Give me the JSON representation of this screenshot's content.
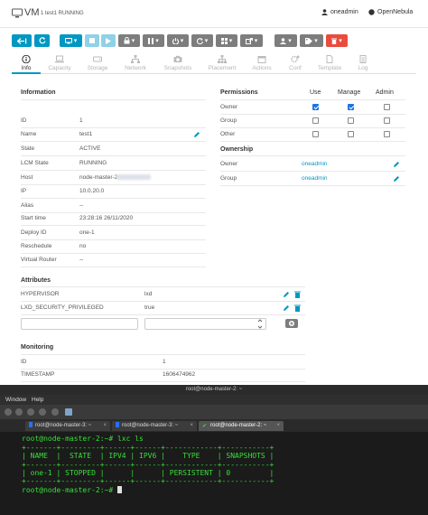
{
  "header": {
    "title": "VM",
    "subtitle": "1 test1 RUNNING",
    "user": "oneadmin",
    "zone": "OpenNebula"
  },
  "tabs": [
    {
      "label": "Info",
      "icon": "info-icon"
    },
    {
      "label": "Capacity",
      "icon": "laptop-icon"
    },
    {
      "label": "Storage",
      "icon": "drive-icon"
    },
    {
      "label": "Network",
      "icon": "network-icon"
    },
    {
      "label": "Snapshots",
      "icon": "camera-icon"
    },
    {
      "label": "Placement",
      "icon": "sitemap-icon"
    },
    {
      "label": "Actions",
      "icon": "calendar-icon"
    },
    {
      "label": "Conf",
      "icon": "gears-icon"
    },
    {
      "label": "Template",
      "icon": "file-icon"
    },
    {
      "label": "Log",
      "icon": "log-icon"
    }
  ],
  "information": {
    "heading": "Information",
    "rows": [
      {
        "label": "ID",
        "value": "1"
      },
      {
        "label": "Name",
        "value": "test1"
      },
      {
        "label": "State",
        "value": "ACTIVE"
      },
      {
        "label": "LCM State",
        "value": "RUNNING"
      },
      {
        "label": "Host",
        "value": "node-master-2"
      },
      {
        "label": "IP",
        "value": "10.0.20.0"
      },
      {
        "label": "Alias",
        "value": "--"
      },
      {
        "label": "Start time",
        "value": "23:28:16 26/11/2020"
      },
      {
        "label": "Deploy ID",
        "value": "one-1"
      },
      {
        "label": "Reschedule",
        "value": "no"
      },
      {
        "label": "Virtual Router",
        "value": "--"
      }
    ]
  },
  "permissions": {
    "heading": "Permissions",
    "columns": [
      "Use",
      "Manage",
      "Admin"
    ],
    "rows": [
      {
        "label": "Owner",
        "use": true,
        "manage": true,
        "admin": false
      },
      {
        "label": "Group",
        "use": false,
        "manage": false,
        "admin": false
      },
      {
        "label": "Other",
        "use": false,
        "manage": false,
        "admin": false
      }
    ]
  },
  "ownership": {
    "heading": "Ownership",
    "rows": [
      {
        "label": "Owner",
        "value": "oneadmin"
      },
      {
        "label": "Group",
        "value": "oneadmin"
      }
    ]
  },
  "attributes": {
    "heading": "Attributes",
    "rows": [
      {
        "key": "HYPERVISOR",
        "value": "lxd"
      },
      {
        "key": "LXD_SECURITY_PRIVILEGED",
        "value": "true"
      }
    ]
  },
  "monitoring": {
    "heading": "Monitoring",
    "rows": [
      {
        "key": "ID",
        "value": "1"
      },
      {
        "key": "TIMESTAMP",
        "value": "1606474962"
      }
    ]
  },
  "terminal": {
    "window_title": "root@node-master-2: ~",
    "menu": [
      "Window",
      "Help"
    ],
    "tabs": [
      "root@node-master-3: ~",
      "root@node-master-3: ~",
      "root@node-master-2: ~"
    ],
    "lines": [
      "root@node-master-2:~# lxc ls",
      "+-------+---------+------+------+------------+-----------+",
      "| NAME  |  STATE  | IPV4 | IPV6 |    TYPE    | SNAPSHOTS |",
      "+-------+---------+------+------+------------+-----------+",
      "| one-1 | STOPPED |      |      | PERSISTENT | 0         |",
      "+-------+---------+------+------+------------+-----------+",
      "root@node-master-2:~#"
    ]
  },
  "colors": {
    "accent": "#0098c3",
    "danger": "#e84c3d",
    "terminal_green": "#35e035"
  }
}
